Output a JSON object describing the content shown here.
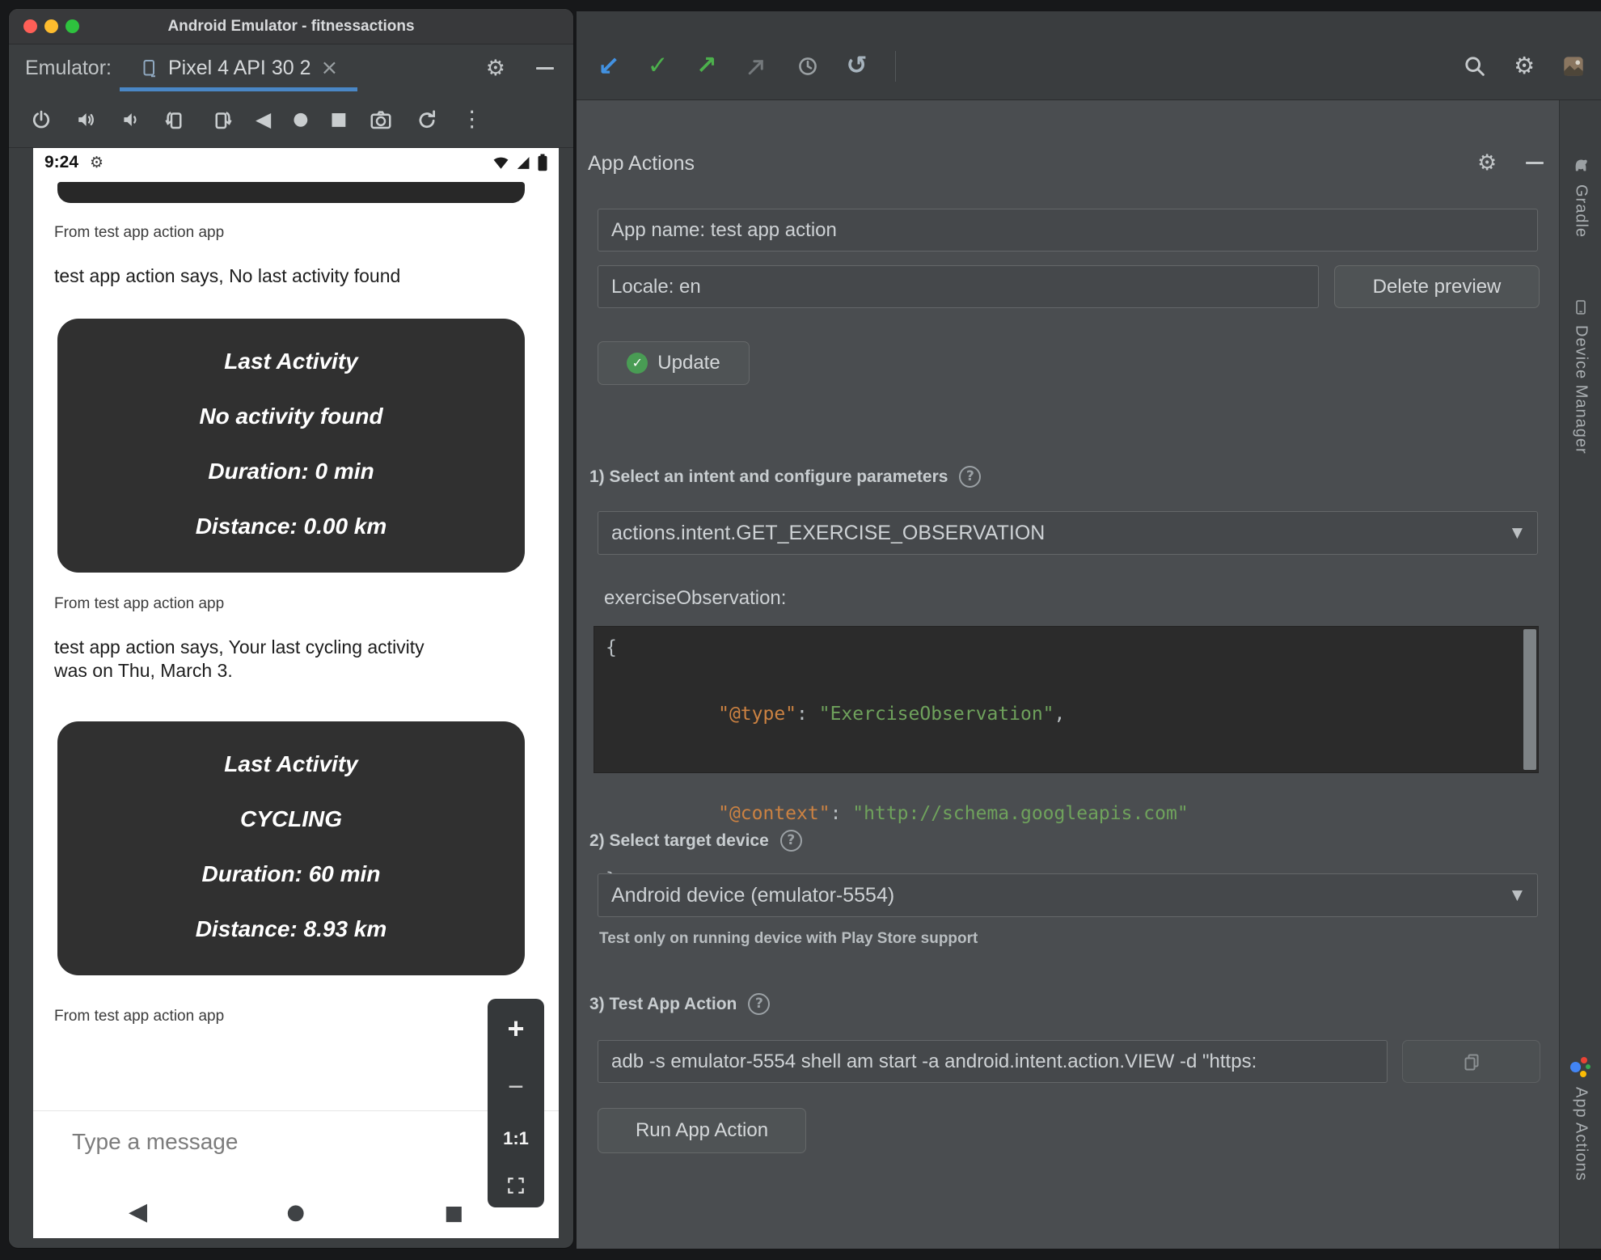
{
  "colors": {
    "mac_close": "#ff5f57",
    "mac_minimize": "#febc2e",
    "mac_zoom": "#2ec23e",
    "tab_accent": "#4a87c6",
    "chrome_bg": "#3b3e40",
    "panel_bg": "#4a4d50",
    "editor_bg": "#2b2b2b",
    "json_key": "#cc8242",
    "json_string": "#6fa25c",
    "update_check_green": "#499c54"
  },
  "icons": {
    "gear": "⚙",
    "back": "◀",
    "home": "●",
    "overview": "■",
    "more": "⋮",
    "dropdown_arrow": "▼",
    "check": "✓",
    "arrow_down_left": "↙",
    "arrow_up_right": "↗",
    "undo": "↺",
    "close": "×",
    "help": "?"
  },
  "emulator": {
    "window_title": "Android Emulator - fitnessactions",
    "toolbar": {
      "label": "Emulator:",
      "tab": "Pixel 4 API 30 2"
    },
    "phone": {
      "time": "9:24",
      "chat": {
        "from1": "From test app action app",
        "msg1": "test app action says, No last activity found",
        "card1": {
          "title": "Last Activity",
          "activity": "No activity found",
          "duration": "Duration: 0 min",
          "distance": "Distance: 0.00 km"
        },
        "from2": "From test app action app",
        "msg2": "test app action says, Your last cycling activity was on Thu, March 3.",
        "card2": {
          "title": "Last Activity",
          "activity": "CYCLING",
          "duration": "Duration: 60 min",
          "distance": "Distance: 8.93 km"
        },
        "from3": "From test app action app"
      },
      "composer_placeholder": "Type a message",
      "zoom": {
        "plus": "+",
        "minus": "−",
        "ratio": "1:1"
      }
    }
  },
  "studio": {
    "panel_title": "App Actions",
    "fields": {
      "app_name": "App name: test app action",
      "locale": "Locale: en"
    },
    "buttons": {
      "delete_preview": "Delete preview",
      "update": "Update",
      "run": "Run App Action"
    },
    "sections": {
      "s1": {
        "label": "1) Select an intent and configure parameters",
        "intent": "actions.intent.GET_EXERCISE_OBSERVATION",
        "param_name": "exerciseObservation:",
        "code": {
          "open": "{",
          "l1_key": "\"@type\"",
          "l1_sep": ": ",
          "l1_val": "\"ExerciseObservation\"",
          "l1_comma": ",",
          "l2_key": "\"@context\"",
          "l2_sep": ": ",
          "l2_val": "\"http://schema.googleapis.com\"",
          "close": "}"
        }
      },
      "s2": {
        "label": "2) Select target device",
        "device": "Android device (emulator-5554)",
        "hint": "Test only on running device with Play Store support"
      },
      "s3": {
        "label": "3) Test App Action",
        "command": "adb -s emulator-5554 shell am start -a android.intent.action.VIEW -d \"https:"
      }
    }
  },
  "side_tabs": {
    "gradle": "Gradle",
    "device_manager": "Device Manager",
    "app_actions": "App Actions"
  }
}
